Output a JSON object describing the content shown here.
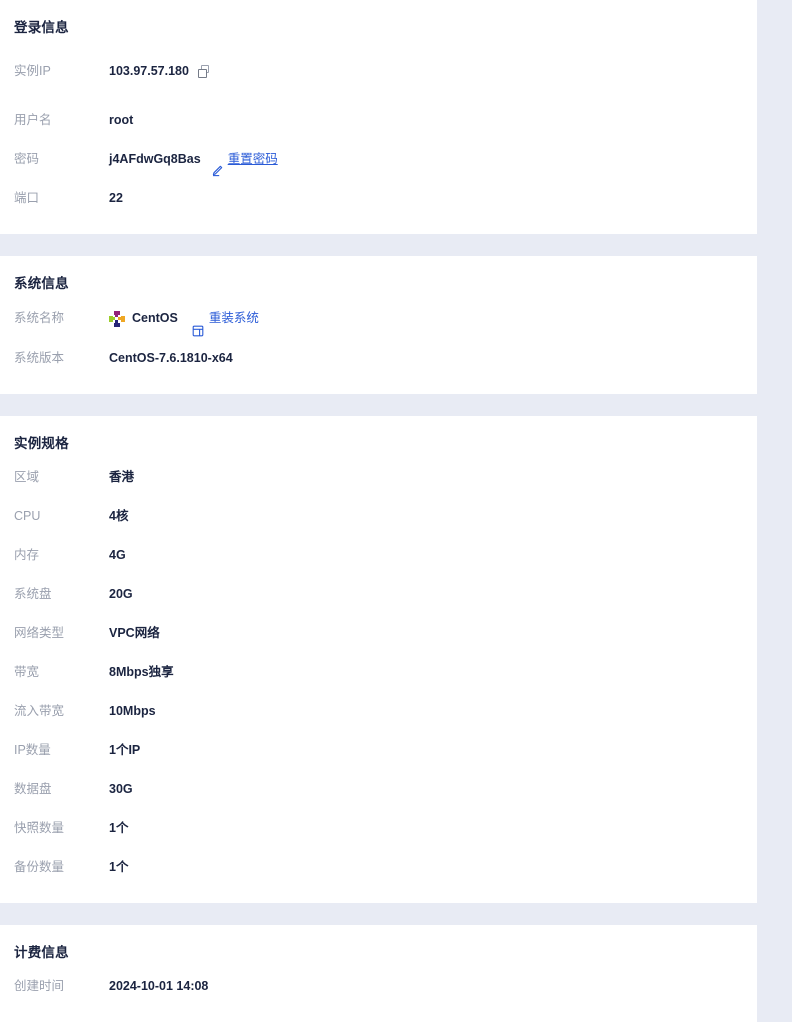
{
  "sections": [
    {
      "id": "login-info",
      "title": "登录信息",
      "rows": [
        {
          "label": "实例IP",
          "value": "103.97.57.180",
          "icon": "copy-icon",
          "spacing": "loose"
        },
        {
          "label": "用户名",
          "value": "root"
        },
        {
          "label": "密码",
          "value": "j4AFdwGq8Bas",
          "action": {
            "icon": "pencil-icon",
            "label": "重置密码",
            "underline": true
          }
        },
        {
          "label": "端口",
          "value": "22"
        }
      ]
    },
    {
      "id": "system-info",
      "title": "系统信息",
      "rows": [
        {
          "label": "系统名称",
          "value": "CentOS",
          "logo": "centos-logo",
          "action": {
            "icon": "reinstall-icon",
            "label": "重装系统",
            "underline": false
          }
        },
        {
          "label": "系统版本",
          "value": "CentOS-7.6.1810-x64"
        }
      ]
    },
    {
      "id": "instance-spec",
      "title": "实例规格",
      "rows": [
        {
          "label": "区域",
          "value": "香港"
        },
        {
          "label": "CPU",
          "value": "4核"
        },
        {
          "label": "内存",
          "value": "4G"
        },
        {
          "label": "系统盘",
          "value": "20G"
        },
        {
          "label": "网络类型",
          "value": "VPC网络"
        },
        {
          "label": "带宽",
          "value": "8Mbps独享"
        },
        {
          "label": "流入带宽",
          "value": "10Mbps"
        },
        {
          "label": "IP数量",
          "value": "1个IP"
        },
        {
          "label": "数据盘",
          "value": "30G"
        },
        {
          "label": "快照数量",
          "value": "1个"
        },
        {
          "label": "备份数量",
          "value": "1个"
        }
      ]
    },
    {
      "id": "billing-info",
      "title": "计费信息",
      "rows": [
        {
          "label": "创建时间",
          "value": "2024-10-01 14:08"
        }
      ]
    }
  ],
  "colors": {
    "page_background": "#e8ebf4",
    "card_background": "#ffffff",
    "label_text": "#9aa0ae",
    "value_text": "#1b2440",
    "link": "#2a5bd7"
  }
}
